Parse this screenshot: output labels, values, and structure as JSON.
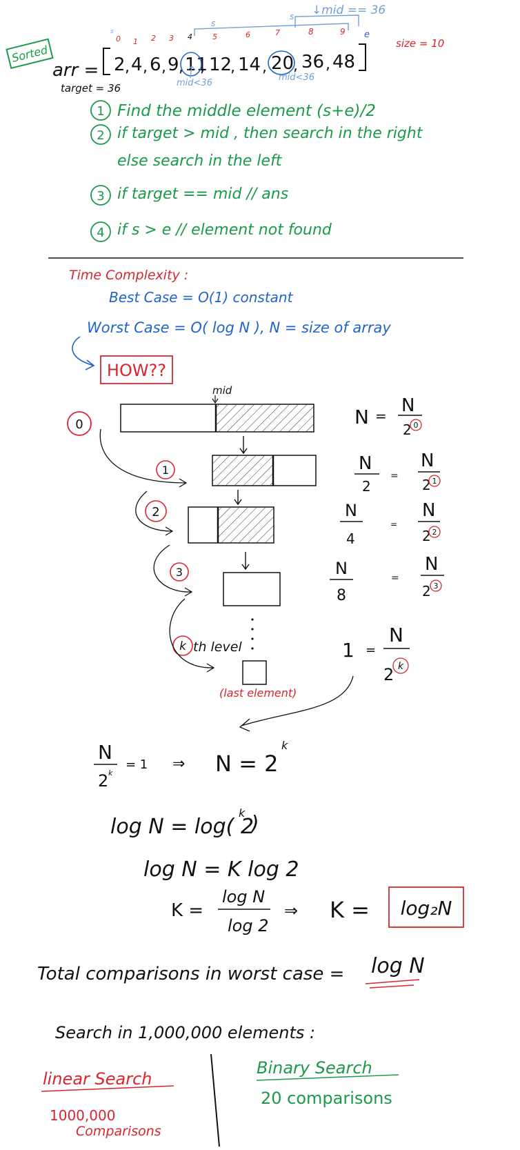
{
  "colors": {
    "ink": "#111111",
    "green": "#1a9a4a",
    "blue": "#1f64c8",
    "lightblue": "#6fa0d8",
    "red": "#d8262e"
  },
  "header": {
    "sorted": "Sorted",
    "arr_label": "arr =",
    "array_values": [
      "2",
      "4",
      "6",
      "9",
      "11",
      "12",
      "14",
      "20",
      "36",
      "48"
    ],
    "indices": [
      "0",
      "1",
      "2",
      "3",
      "4",
      "5",
      "6",
      "7",
      "8",
      "9"
    ],
    "size": "size = 10",
    "mid_36": "↓mid == 36",
    "s_label_top": "s",
    "e_label": "e",
    "s_over_5": "s",
    "s_over_0": "s",
    "mid_lt_a": "mid<36",
    "mid_lt_b": "mid<36",
    "target": "target = 36"
  },
  "steps": [
    {
      "num": "1",
      "text": "Find the middle element (s+e)/2"
    },
    {
      "num": "2",
      "text": "if target > mid , then search in the right"
    },
    {
      "num": "",
      "text": "else search in the left"
    },
    {
      "num": "3",
      "text": "if target == mid    // ans"
    },
    {
      "num": "4",
      "text": "if s > e  // element not found"
    }
  ],
  "complexity": {
    "heading": "Time Complexity :",
    "best": "Best Case = O(1) constant",
    "worst": "Worst Case = O( log N ),  N = size of array",
    "how": "HOW??"
  },
  "diagram": {
    "mid": "mid",
    "levels": [
      "0",
      "1",
      "2",
      "3",
      "k"
    ],
    "kth_level": "th level",
    "last_element": "(last element)",
    "eq": [
      {
        "lhs": "N",
        "rhs_num": "N",
        "rhs_den": "2",
        "pow": "0"
      },
      {
        "lhs_num": "N",
        "lhs_den": "2",
        "rhs_num": "N",
        "rhs_den": "2",
        "pow": "1"
      },
      {
        "lhs_num": "N",
        "lhs_den": "4",
        "rhs_num": "N",
        "rhs_den": "2",
        "pow": "2"
      },
      {
        "lhs_num": "N",
        "lhs_den": "8",
        "rhs_num": "N",
        "rhs_den": "2",
        "pow": "3"
      },
      {
        "lhs": "1",
        "rhs_num": "N",
        "rhs_den": "2",
        "pow": "k"
      }
    ]
  },
  "derivation": {
    "line1_num": "N",
    "line1_den": "2",
    "line1_pow": "k",
    "line1_rest": "= 1",
    "implies": "⇒",
    "line1_right": "N = 2",
    "line1_right_pow": "k",
    "line2": "log N = log( 2",
    "line2_pow": "k",
    "line2_end": ")",
    "line3": "log N = K log 2",
    "line4_k": "K =",
    "line4_num": "log N",
    "line4_den": "log 2",
    "line4_result_k": "K =",
    "result": "log₂N"
  },
  "total": {
    "text": "Total comparisons in worst case =",
    "value": "log N"
  },
  "search": {
    "heading": "Search in 1,000,000 elements :",
    "linear_title": "linear Search",
    "linear_value": "1000,000",
    "linear_sub": "Comparisons",
    "binary_title": "Binary Search",
    "binary_value": "20 comparisons"
  }
}
